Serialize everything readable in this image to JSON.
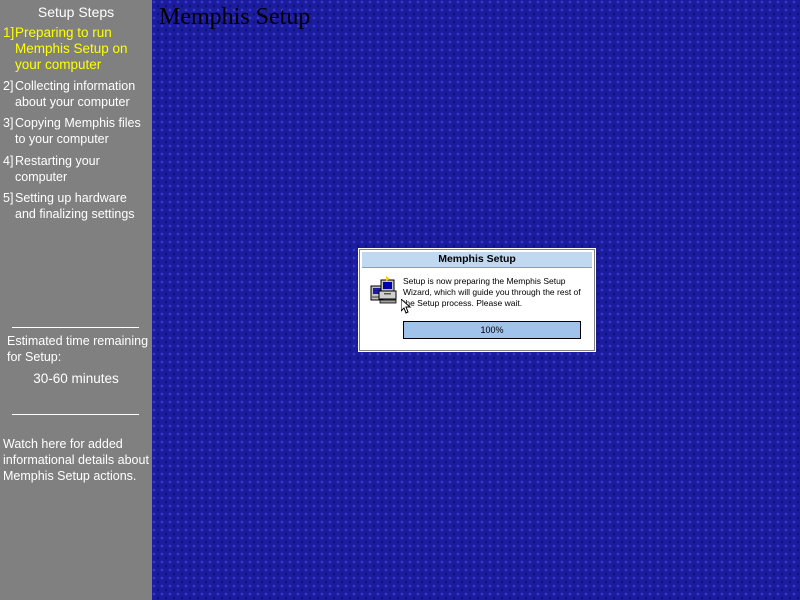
{
  "sidebar": {
    "title": "Setup Steps",
    "steps": [
      {
        "num": "1]",
        "label": "Preparing to run Memphis Setup on your computer",
        "active": true
      },
      {
        "num": "2]",
        "label": "Collecting information about your computer",
        "active": false
      },
      {
        "num": "3]",
        "label": "Copying Memphis files to your computer",
        "active": false
      },
      {
        "num": "4]",
        "label": "Restarting your computer",
        "active": false
      },
      {
        "num": "5]",
        "label": "Setting up hardware and finalizing settings",
        "active": false
      }
    ],
    "estimate_label": "Estimated time remaining for Setup:",
    "estimate_value": "30-60 minutes",
    "info_text": "Watch here for added informational details about Memphis Setup actions."
  },
  "main": {
    "title": "Memphis Setup"
  },
  "dialog": {
    "title": "Memphis Setup",
    "icon": "setup-computer-icon",
    "message": "Setup is now preparing the Memphis Setup Wizard, which will guide you through the rest of the Setup process.  Please wait.",
    "progress_percent": 100,
    "progress_text": "100%"
  },
  "colors": {
    "sidebar_bg": "#808080",
    "active_step": "#ffff00",
    "desktop_bg": "#1c1c9e",
    "progress_fill": "#9fc3ea",
    "titlebar_bg": "#c0d8f0"
  }
}
